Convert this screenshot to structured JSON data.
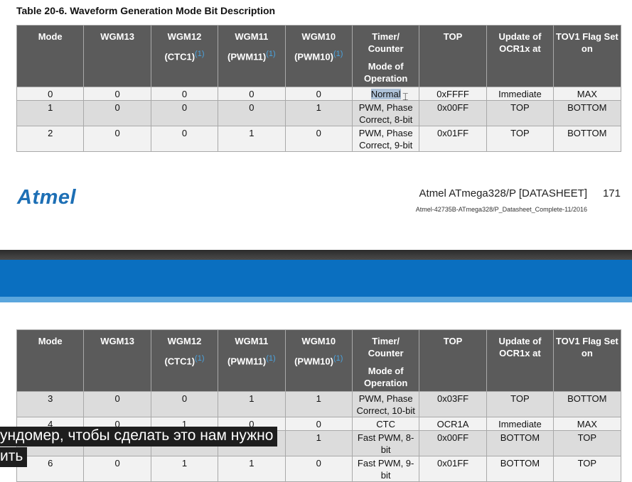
{
  "page": {
    "table_title": "Table 20-6.  Waveform Generation Mode Bit Description",
    "logo_text": "Atmel",
    "datasheet_title": "Atmel ATmega328/P [DATASHEET]",
    "page_number": "171",
    "datasheet_ref": "Atmel-42735B-ATmega328/P_Datasheet_Complete-11/2016"
  },
  "headers": {
    "mode": "Mode",
    "wgm13": "WGM13",
    "wgm12": "WGM12",
    "wgm12_sub": "(CTC1)",
    "wgm11": "WGM11",
    "wgm11_sub": "(PWM11)",
    "wgm10": "WGM10",
    "wgm10_sub": "(PWM10)",
    "note": "(1)",
    "timer": "Timer/ Counter",
    "timer_sub": "Mode of Operation",
    "top": "TOP",
    "update": "Update of OCR1x at",
    "tov": "TOV1 Flag Set on"
  },
  "table1_rows": [
    [
      "0",
      "0",
      "0",
      "0",
      "0",
      "Normal",
      "0xFFFF",
      "Immediate",
      "MAX"
    ],
    [
      "1",
      "0",
      "0",
      "0",
      "1",
      "PWM, Phase Correct, 8-bit",
      "0x00FF",
      "TOP",
      "BOTTOM"
    ],
    [
      "2",
      "0",
      "0",
      "1",
      "0",
      "PWM, Phase Correct, 9-bit",
      "0x01FF",
      "TOP",
      "BOTTOM"
    ]
  ],
  "table2_rows": [
    [
      "3",
      "0",
      "0",
      "1",
      "1",
      "PWM, Phase Correct, 10-bit",
      "0x03FF",
      "TOP",
      "BOTTOM"
    ],
    [
      "4",
      "0",
      "1",
      "0",
      "0",
      "CTC",
      "OCR1A",
      "Immediate",
      "MAX"
    ],
    [
      "5",
      "0",
      "1",
      "0",
      "1",
      "Fast PWM, 8-bit",
      "0x00FF",
      "BOTTOM",
      "TOP"
    ],
    [
      "6",
      "0",
      "1",
      "1",
      "0",
      "Fast PWM, 9-bit",
      "0x01FF",
      "BOTTOM",
      "TOP"
    ]
  ],
  "subtitles": {
    "line1": "ундомер, чтобы сделать это  нам нужно",
    "line2": "ить"
  },
  "colors": {
    "header_bg": "#5b5b5b",
    "row_a": "#f2f2f2",
    "row_b": "#dcdcdc",
    "highlight": "#aec2d8",
    "link_blue": "#4aa3df",
    "band_blue": "#0a6fc0",
    "logo_blue": "#1d6fb5"
  },
  "icons": {
    "cursor": "text-cursor-icon"
  }
}
